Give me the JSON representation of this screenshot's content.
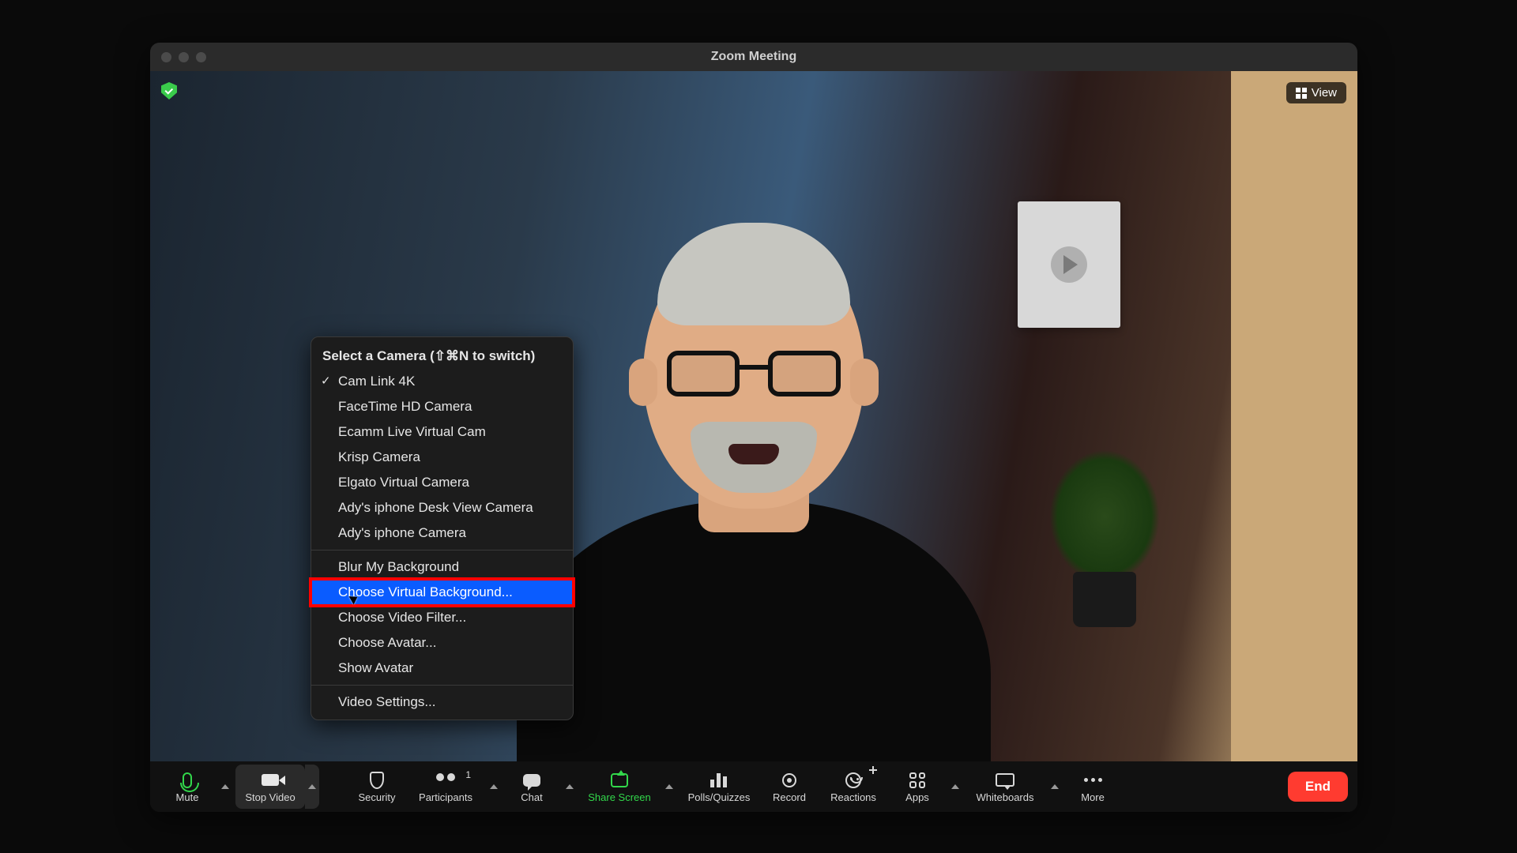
{
  "window": {
    "title": "Zoom Meeting"
  },
  "topbar": {
    "view": "View"
  },
  "camera_menu": {
    "header": "Select a Camera (⇧⌘N to switch)",
    "items": [
      "Cam Link 4K",
      "FaceTime HD Camera",
      "Ecamm Live Virtual Cam",
      "Krisp Camera",
      "Elgato Virtual Camera",
      "Ady's iphone Desk View Camera",
      "Ady's iphone Camera"
    ],
    "checked_index": 0,
    "bg_items": [
      "Blur My Background",
      "Choose Virtual Background...",
      "Choose Video Filter...",
      "Choose Avatar...",
      "Show Avatar"
    ],
    "highlighted_bg_index": 1,
    "settings": "Video Settings..."
  },
  "toolbar": {
    "mute": "Mute",
    "stop_video": "Stop Video",
    "security": "Security",
    "participants": "Participants",
    "participants_count": "1",
    "chat": "Chat",
    "share_screen": "Share Screen",
    "polls": "Polls/Quizzes",
    "record": "Record",
    "reactions": "Reactions",
    "apps": "Apps",
    "whiteboards": "Whiteboards",
    "more": "More",
    "end": "End"
  }
}
